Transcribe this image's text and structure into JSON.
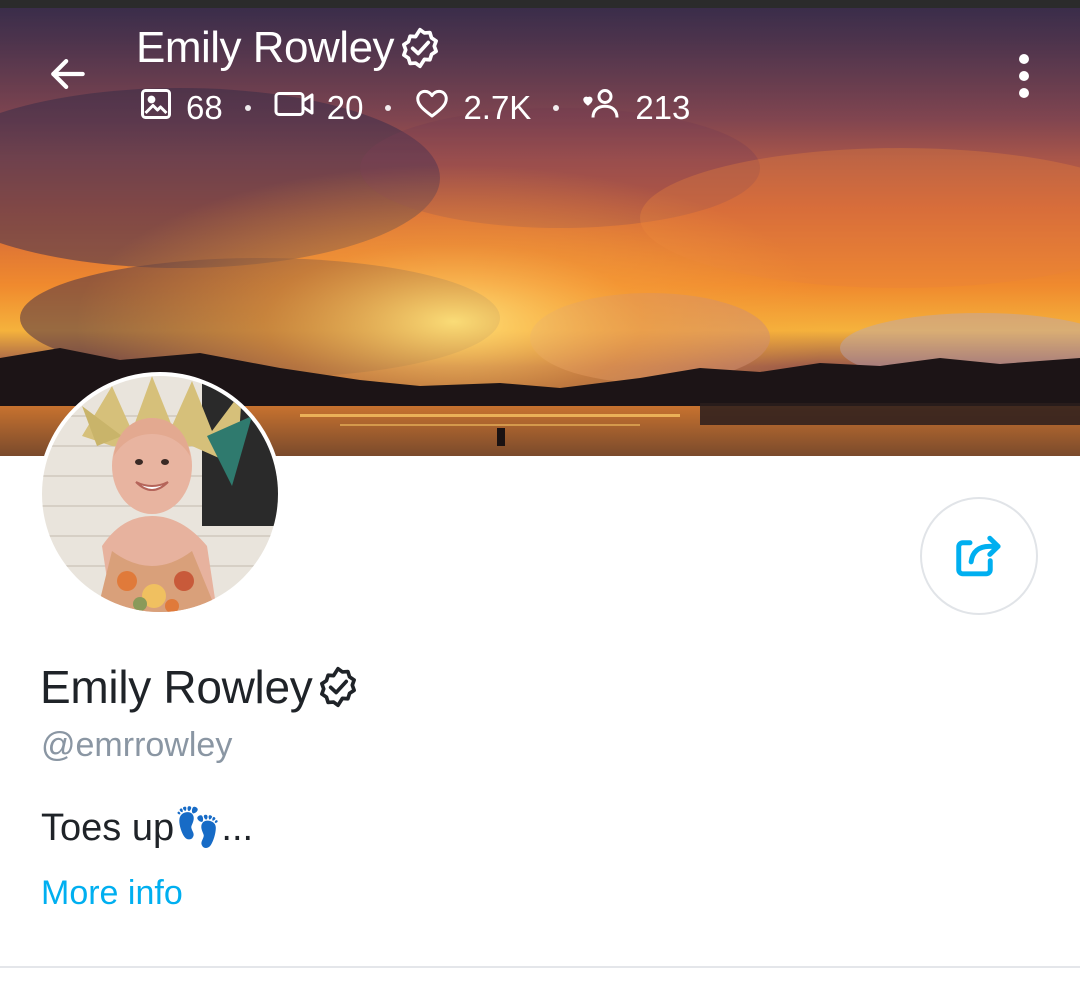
{
  "header": {
    "title": "Emily Rowley",
    "stats": {
      "photos": "68",
      "videos": "20",
      "likes": "2.7K",
      "fans": "213"
    },
    "icons": [
      "back-arrow-icon",
      "verified-icon",
      "image-icon",
      "video-icon",
      "heart-icon",
      "fans-icon",
      "more-vertical-icon"
    ]
  },
  "profile": {
    "name": "Emily Rowley",
    "handle": "@emrrowley",
    "bio": "Toes up👣...",
    "more_info": "More info"
  },
  "colors": {
    "accent": "#00aff0",
    "handle_gray": "#8a96a3",
    "text_dark": "#1f2328",
    "divider": "#e4e6ea"
  }
}
